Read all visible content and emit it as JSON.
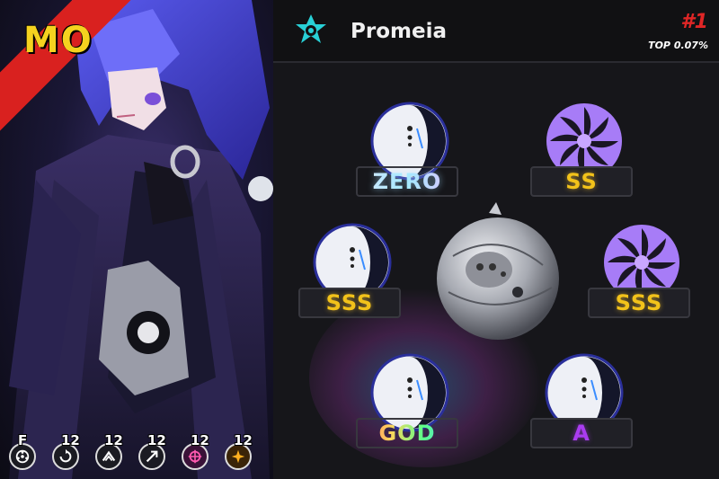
{
  "character": {
    "rank_letter": "MO",
    "stats": [
      {
        "value": "F",
        "icon": "disc-icon"
      },
      {
        "value": "12",
        "icon": "skill-refresh-icon"
      },
      {
        "value": "12",
        "icon": "skill-split-icon"
      },
      {
        "value": "12",
        "icon": "skill-arrow-icon"
      },
      {
        "value": "12",
        "icon": "skill-target-icon"
      },
      {
        "value": "12",
        "icon": "skill-burst-icon"
      }
    ]
  },
  "weapon": {
    "name": "Promeia",
    "icon": "star-gear-icon",
    "rank": "#1",
    "top_percent": "TOP 0.07%"
  },
  "slots": [
    {
      "id": "top-left",
      "grade": "ZERO",
      "icon": "lunar-matrix-icon"
    },
    {
      "id": "top-right",
      "grade": "SS",
      "icon": "purple-vortex-icon"
    },
    {
      "id": "mid-left",
      "grade": "SSS",
      "icon": "lunar-matrix-icon"
    },
    {
      "id": "mid-right",
      "grade": "SSS",
      "icon": "purple-vortex-icon"
    },
    {
      "id": "bottom-left",
      "grade": "GOD",
      "icon": "lunar-matrix-icon"
    },
    {
      "id": "bottom-right",
      "grade": "A",
      "icon": "lunar-matrix-icon"
    }
  ],
  "colors": {
    "accent_red": "#d9211f",
    "rank_yellow": "#f5d21f",
    "sss_gold": "#f2c21a",
    "a_purple": "#a93cf0"
  }
}
